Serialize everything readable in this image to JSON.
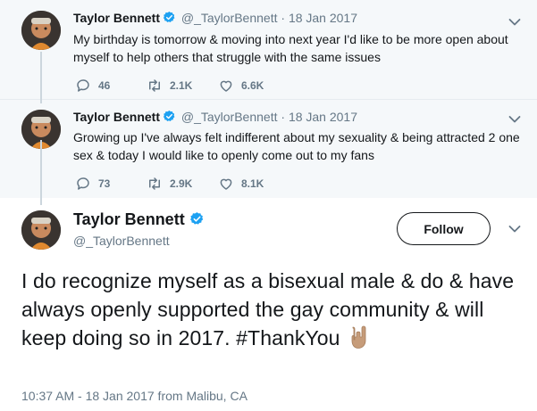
{
  "tweets": [
    {
      "name": "Taylor Bennett",
      "handle": "@_TaylorBennett",
      "separator": "·",
      "date": "18 Jan 2017",
      "text": "My birthday is tomorrow & moving into next year I'd like to be more open about myself to help others that struggle with the same issues",
      "replies": "46",
      "retweets": "2.1K",
      "likes": "6.6K"
    },
    {
      "name": "Taylor Bennett",
      "handle": "@_TaylorBennett",
      "separator": "·",
      "date": "18 Jan 2017",
      "text": "Growing up I've always felt indifferent about my sexuality & being attracted 2 one sex & today I would like to openly come out to my fans",
      "replies": "73",
      "retweets": "2.9K",
      "likes": "8.1K"
    }
  ],
  "main": {
    "name": "Taylor Bennett",
    "handle": "@_TaylorBennett",
    "follow_label": "Follow",
    "text": "I do recognize myself as a bisexual male & do & have always openly supported the gay community & will keep doing so in 2017. #ThankYou",
    "timestamp": "10:37 AM - 18 Jan 2017 from Malibu, CA",
    "emoji": "rock-on-hand-emoji"
  },
  "colors": {
    "verified": "#1da1f2",
    "muted": "#657786",
    "context_bg": "#f5f8fa",
    "thread_line": "#ccd6dd"
  }
}
